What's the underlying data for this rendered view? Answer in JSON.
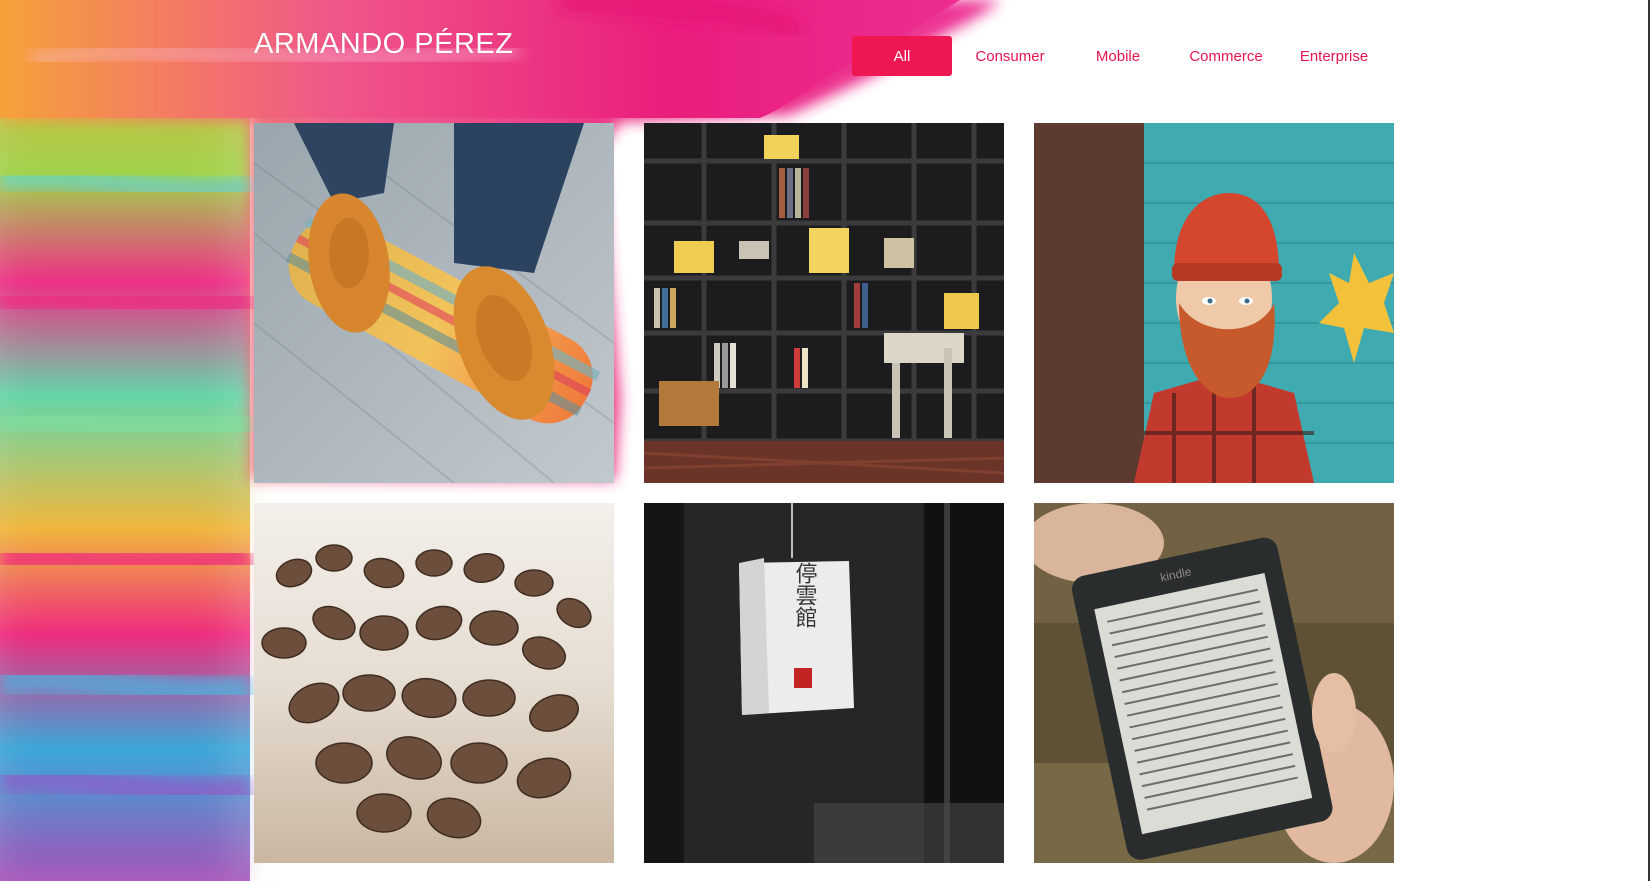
{
  "header": {
    "title": "ARMANDO PÉREZ"
  },
  "filters": {
    "items": [
      {
        "label": "All",
        "active": true
      },
      {
        "label": "Consumer",
        "active": false
      },
      {
        "label": "Mobile",
        "active": false
      },
      {
        "label": "Commerce",
        "active": false
      },
      {
        "label": "Enterprise",
        "active": false
      }
    ]
  },
  "gallery": {
    "items": [
      {
        "subject": "orange brogue shoes on skateboard"
      },
      {
        "subject": "bookshelf with records and books"
      },
      {
        "subject": "street mural of bearded man with red beanie"
      },
      {
        "subject": "coffee beans"
      },
      {
        "subject": "paper lantern with kanji"
      },
      {
        "subject": "hand holding kindle e-reader"
      }
    ],
    "lantern_text": "停雲館",
    "kindle_label": "kindle"
  },
  "colors": {
    "accent": "#ef1752",
    "accent_text": "#e8164f",
    "title_text": "#ffffff"
  }
}
